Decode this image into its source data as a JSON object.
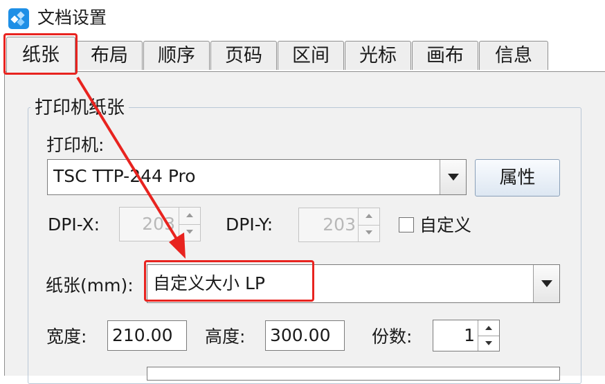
{
  "window": {
    "title": "文档设置",
    "icon": "app-logo-icon"
  },
  "tabs": [
    {
      "label": "纸张",
      "active": true
    },
    {
      "label": "布局"
    },
    {
      "label": "顺序"
    },
    {
      "label": "页码"
    },
    {
      "label": "区间"
    },
    {
      "label": "光标"
    },
    {
      "label": "画布"
    },
    {
      "label": "信息"
    }
  ],
  "printer_group": {
    "title": "打印机纸张",
    "printer_label": "打印机:",
    "printer_value": "TSC TTP-244 Pro",
    "properties_button": "属性",
    "dpi_x_label": "DPI-X:",
    "dpi_x_value": "203",
    "dpi_y_label": "DPI-Y:",
    "dpi_y_value": "203",
    "custom_label": "自定义",
    "paper_label": "纸张(mm):",
    "paper_value": "自定义大小 LP",
    "width_label": "宽度:",
    "width_value": "210.00",
    "height_label": "高度:",
    "height_value": "300.00",
    "copies_label": "份数:",
    "copies_value": "1"
  },
  "colors": {
    "annotation": "#e8231f",
    "panel": "#f1f1f1",
    "accent": "#1e8fe6"
  }
}
